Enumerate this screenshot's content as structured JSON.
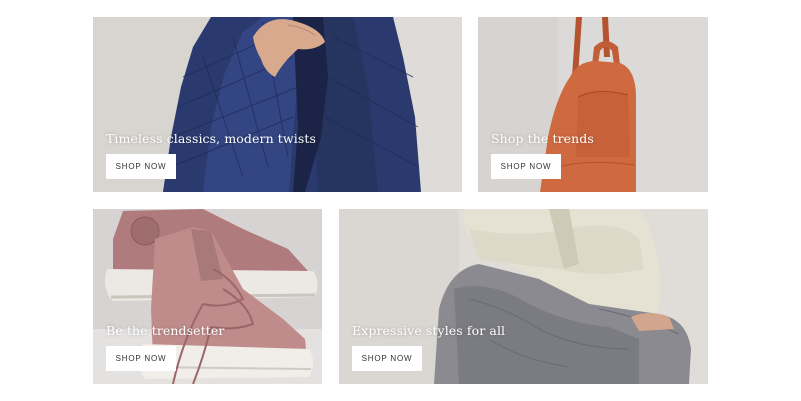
{
  "tiles": [
    {
      "caption": "Timeless classics, modern twists",
      "button": "SHOP NOW"
    },
    {
      "caption": "Shop the trends",
      "button": "SHOP NOW"
    },
    {
      "caption": "Be the trendsetter",
      "button": "SHOP NOW"
    },
    {
      "caption": "Expressive styles for all",
      "button": "SHOP NOW"
    }
  ]
}
